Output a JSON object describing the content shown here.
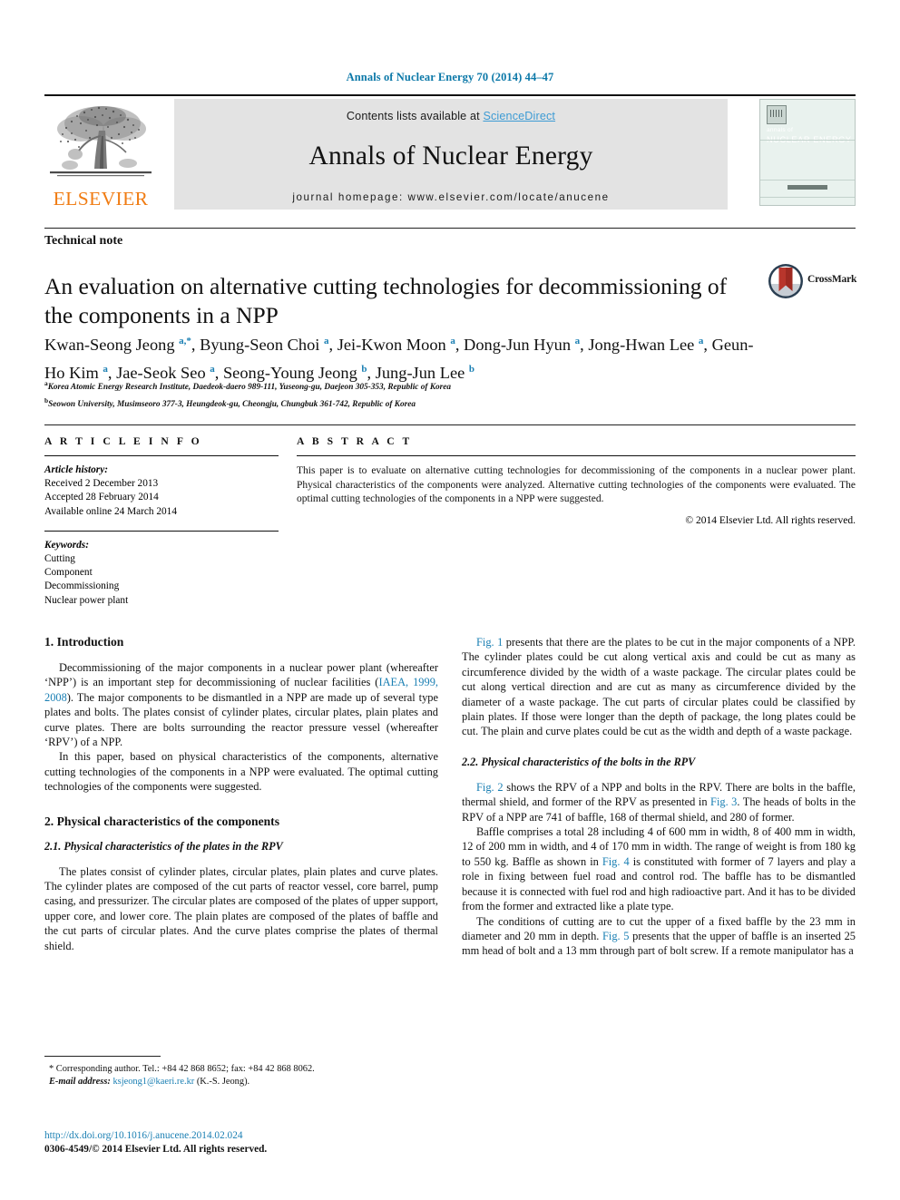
{
  "running_head": "Annals of Nuclear Energy 70 (2014) 44–47",
  "masthead": {
    "publisher_wordmark": "ELSEVIER",
    "contents_prefix": "Contents lists available at ",
    "contents_link": "ScienceDirect",
    "journal_title": "Annals of Nuclear Energy",
    "homepage": "journal homepage: www.elsevier.com/locate/anucene",
    "cover": {
      "annals_of": "annals of",
      "journal_name": "NUCLEAR ENERGY"
    },
    "accent_link_color": "#3d9bd4",
    "elsevier_orange": "#f07c13"
  },
  "article": {
    "type": "Technical note",
    "title": "An evaluation on alternative cutting technologies for decommissioning of the components in a NPP",
    "crossmark_label": "CrossMark",
    "authors_html": "Kwan-Seong Jeong <sup>a,*</sup>, Byung-Seon Choi <sup>a</sup>, Jei-Kwon Moon <sup>a</sup>, Dong-Jun Hyun <sup>a</sup>, Jong-Hwan Lee <sup>a</sup>, Geun-Ho Kim <sup>a</sup>, Jae-Seok Seo <sup>a</sup>, Seong-Young Jeong <sup>b</sup>, Jung-Jun Lee <sup>b</sup>",
    "affiliations": [
      {
        "marker": "a",
        "text": "Korea Atomic Energy Research Institute, Daedeok-daero 989-111, Yuseong-gu, Daejeon 305-353, Republic of Korea"
      },
      {
        "marker": "b",
        "text": "Seowon University, Musimseoro 377-3, Heungdeok-gu, Cheongju, Chungbuk 361-742, Republic of Korea"
      }
    ]
  },
  "article_info": {
    "heading": "A R T I C L E   I N F O",
    "history_label": "Article history:",
    "history": [
      "Received 2 December 2013",
      "Accepted 28 February 2014",
      "Available online 24 March 2014"
    ],
    "keywords_label": "Keywords:",
    "keywords": [
      "Cutting",
      "Component",
      "Decommissioning",
      "Nuclear power plant"
    ]
  },
  "abstract": {
    "heading": "A B S T R A C T",
    "text": "This paper is to evaluate on alternative cutting technologies for decommissioning of the components in a nuclear power plant. Physical characteristics of the components were analyzed. Alternative cutting technologies of the components were evaluated. The optimal cutting technologies of the components in a NPP were suggested.",
    "copyright": "© 2014 Elsevier Ltd. All rights reserved."
  },
  "body": {
    "left": {
      "h1_intro": "1. Introduction",
      "p1_a": "Decommissioning of the major components in a nuclear power plant (whereafter ‘NPP’) is an important step for decommissioning of nuclear facilities (",
      "p1_ref": "IAEA, 1999, 2008",
      "p1_b": "). The major components to be dismantled in a NPP are made up of several type plates and bolts. The plates consist of cylinder plates, circular plates, plain plates and curve plates. There are bolts surrounding the reactor pressure vessel (whereafter ‘RPV’) of a NPP.",
      "p2": "In this paper, based on physical characteristics of the components, alternative cutting technologies of the components in a NPP were evaluated. The optimal cutting technologies of the components were suggested.",
      "h1_phys": "2. Physical characteristics of the components",
      "h2_plates": "2.1. Physical characteristics of the plates in the RPV",
      "p3": "The plates consist of cylinder plates, circular plates, plain plates and curve plates. The cylinder plates are composed of the cut parts of reactor vessel, core barrel, pump casing, and pressurizer. The circular plates are composed of the plates of upper support, upper core, and lower core. The plain plates are composed of the plates of baffle and the cut parts of circular plates. And the curve plates comprise the plates of thermal shield."
    },
    "right": {
      "p1_ref": "Fig. 1",
      "p1_a": " presents that there are the plates to be cut in the major components of a NPP. The cylinder plates could be cut along vertical axis and could be cut as many as circumference divided by the width of a waste package. The circular plates could be cut along vertical direction and are cut as many as circumference divided by the diameter of a waste package. The cut parts of circular plates could be classified by plain plates. If those were longer than the depth of package, the long plates could be cut. The plain and curve plates could be cut as the width and depth of a waste package.",
      "h2_bolts": "2.2. Physical characteristics of the bolts in the RPV",
      "p2_ref1": "Fig. 2",
      "p2_a": " shows the RPV of a NPP and bolts in the RPV. There are bolts in the baffle, thermal shield, and former of the RPV as presented in ",
      "p2_ref2": "Fig. 3",
      "p2_b": ". The heads of bolts in the RPV of a NPP are 741 of baffle, 168 of thermal shield, and 280 of former.",
      "p3_a": "Baffle comprises a total 28 including 4 of 600 mm in width, 8 of 400 mm in width, 12 of 200 mm in width, and 4 of 170 mm in width. The range of weight is from 180 kg to 550 kg. Baffle as shown in ",
      "p3_ref": "Fig. 4",
      "p3_b": " is constituted with former of 7 layers and play a role in fixing between fuel road and control rod. The baffle has to be dismantled because it is connected with fuel rod and high radioactive part. And it has to be divided from the former and extracted like a plate type.",
      "p4_a": "The conditions of cutting are to cut the upper of a fixed baffle by the 23 mm in diameter and 20 mm in depth. ",
      "p4_ref": "Fig. 5",
      "p4_b": " presents that the upper of baffle is an inserted 25 mm head of bolt and a 13 mm through part of bolt screw. If a remote manipulator has a"
    }
  },
  "footnote": {
    "corresponding": "* Corresponding author. Tel.: +84 42 868 8652; fax: +84 42 868 8062.",
    "email_label": "E-mail address:",
    "email": "ksjeong1@kaeri.re.kr",
    "email_suffix": " (K.-S. Jeong)."
  },
  "footer": {
    "doi": "http://dx.doi.org/10.1016/j.anucene.2014.02.024",
    "issn_line": "0306-4549/© 2014 Elsevier Ltd. All rights reserved."
  }
}
